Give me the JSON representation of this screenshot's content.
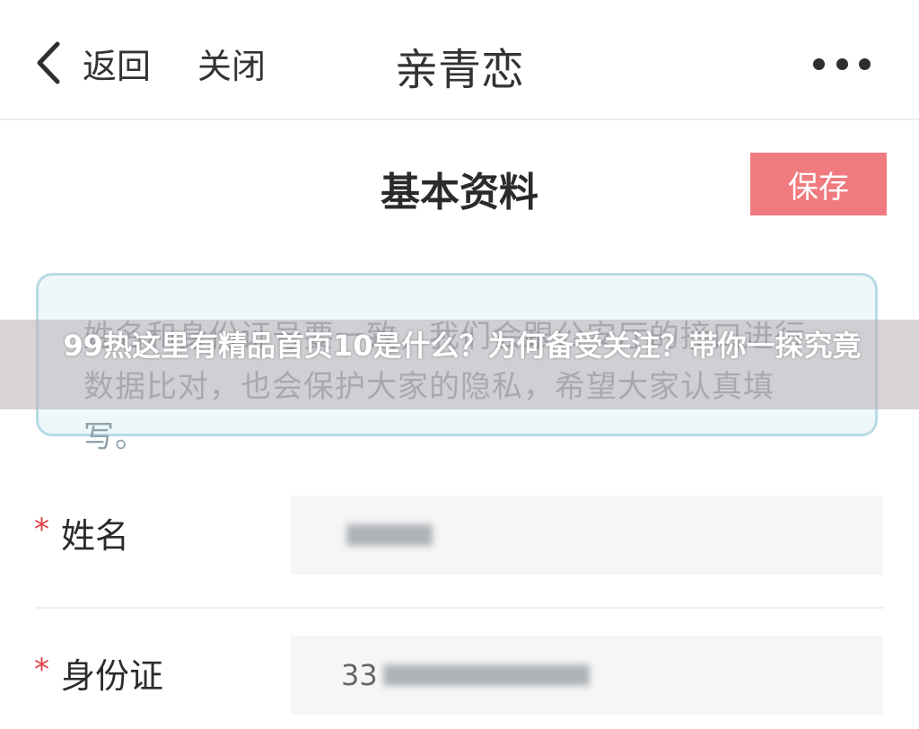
{
  "nav": {
    "back_label": "返回",
    "close_label": "关闭",
    "title": "亲青恋"
  },
  "page": {
    "title": "基本资料",
    "save_label": "保存"
  },
  "notice": {
    "text": "姓名和身份证号要一致，我们会跟公安厅的接口进行数据比对，也会保护大家的隐私，希望大家认真填写。"
  },
  "overlay": {
    "headline": "99热这里有精品首页10是什么？为何备受关注？带你一探究竟"
  },
  "form": {
    "required_mark": "*",
    "name": {
      "label": "姓名",
      "value": ""
    },
    "id_card": {
      "label": "身份证",
      "value": "33"
    }
  },
  "colors": {
    "accent": "#f07b7f",
    "required": "#e0434b",
    "notice_border": "#b9dae4"
  }
}
